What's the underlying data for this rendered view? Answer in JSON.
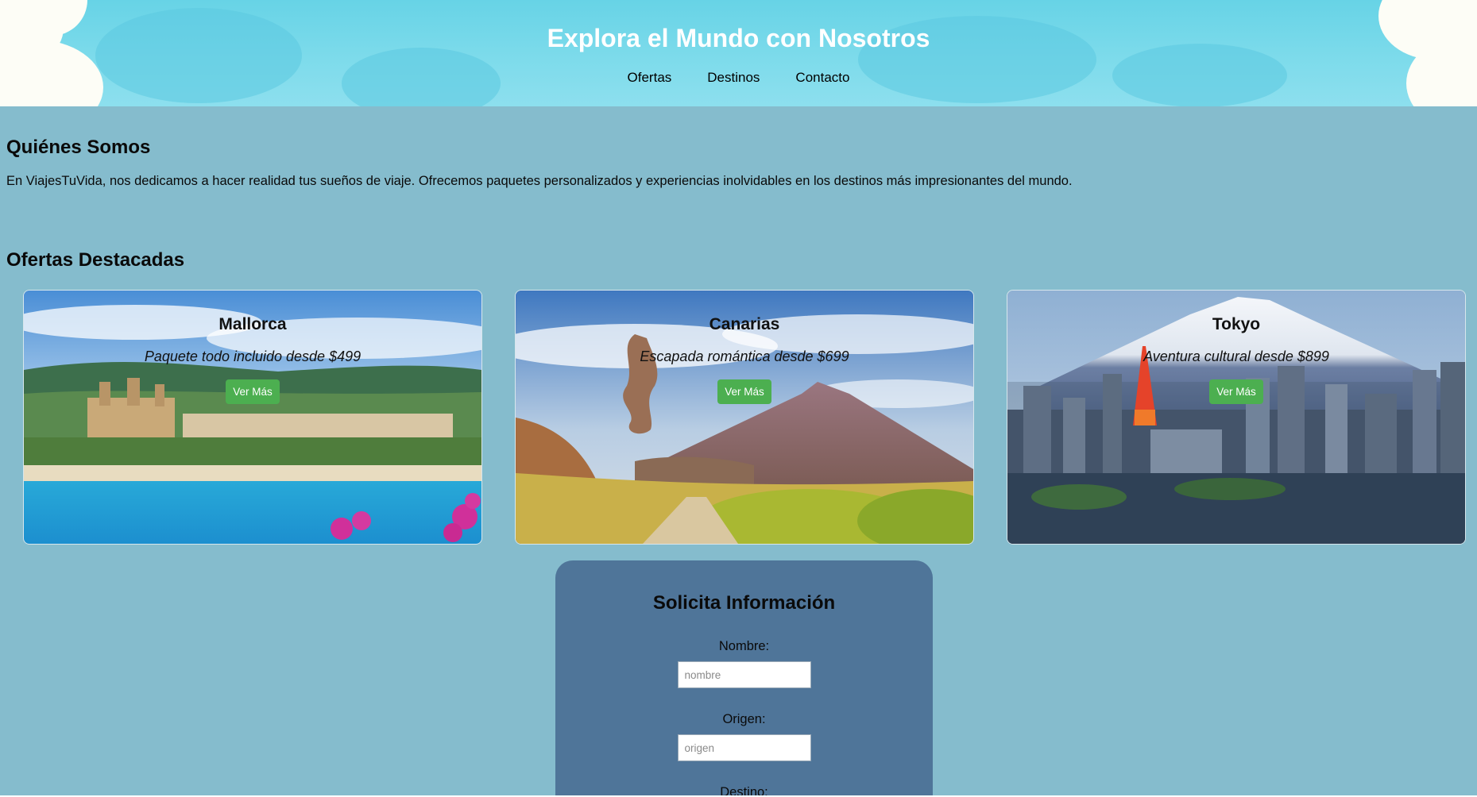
{
  "header": {
    "title": "Explora el Mundo con Nosotros",
    "nav": [
      "Ofertas",
      "Destinos",
      "Contacto"
    ]
  },
  "about": {
    "heading": "Quiénes Somos",
    "text": "En ViajesTuVida, nos dedicamos a hacer realidad tus sueños de viaje. Ofrecemos paquetes personalizados y experiencias inolvidables en los destinos más impresionantes del mundo."
  },
  "offers": {
    "heading": "Ofertas Destacadas",
    "cards": [
      {
        "name": "Mallorca",
        "desc": "Paquete todo incluido desde $499",
        "button": "Ver Más"
      },
      {
        "name": "Canarias",
        "desc": "Escapada romántica desde $699",
        "button": "Ver Más"
      },
      {
        "name": "Tokyo",
        "desc": "Aventura cultural desde $899",
        "button": "Ver Más"
      }
    ]
  },
  "form": {
    "heading": "Solicita Información",
    "fields": [
      {
        "label": "Nombre:",
        "placeholder": "nombre"
      },
      {
        "label": "Origen:",
        "placeholder": "origen"
      },
      {
        "label": "Destino:",
        "placeholder": ""
      }
    ]
  },
  "colors": {
    "header_bg": "#6fd6e8",
    "page_bg": "#85bccd",
    "form_bg": "#4f7599",
    "button_bg": "#4caf50"
  }
}
